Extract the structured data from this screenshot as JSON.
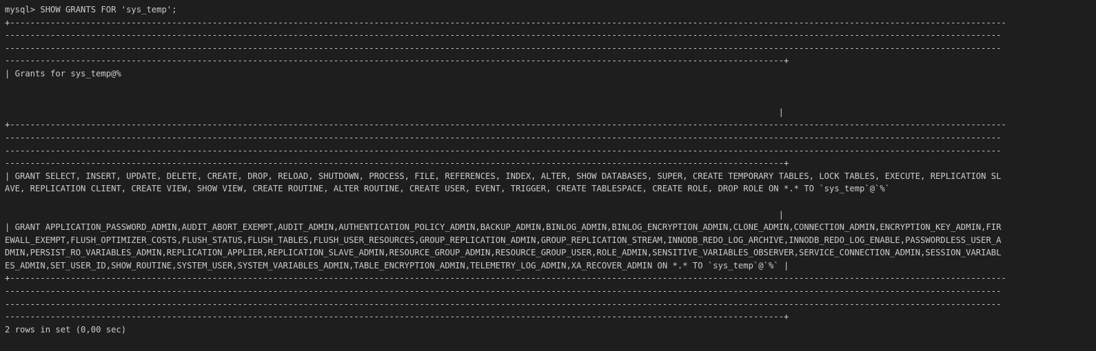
{
  "terminal": {
    "prompt": "mysql> SHOW GRANTS FOR 'sys_temp';",
    "border_top": [
      "+-----------------------------------------------------------------------------------------------------------------------------------------------------------------------------------------------------",
      "-----------------------------------------------------------------------------------------------------------------------------------------------------------------------------------------------------",
      "-----------------------------------------------------------------------------------------------------------------------------------------------------------------------------------------------------",
      "----------------------------------------------------------------------------------------------------------------------------------------------------------+"
    ],
    "header": "| Grants for sys_temp@%",
    "header_end": "                                                                                                                                                         |",
    "border_mid": [
      "+-----------------------------------------------------------------------------------------------------------------------------------------------------------------------------------------------------",
      "-----------------------------------------------------------------------------------------------------------------------------------------------------------------------------------------------------",
      "-----------------------------------------------------------------------------------------------------------------------------------------------------------------------------------------------------",
      "----------------------------------------------------------------------------------------------------------------------------------------------------------+"
    ],
    "row1": [
      "| GRANT SELECT, INSERT, UPDATE, DELETE, CREATE, DROP, RELOAD, SHUTDOWN, PROCESS, FILE, REFERENCES, INDEX, ALTER, SHOW DATABASES, SUPER, CREATE TEMPORARY TABLES, LOCK TABLES, EXECUTE, REPLICATION SL",
      "AVE, REPLICATION CLIENT, CREATE VIEW, SHOW VIEW, CREATE ROUTINE, ALTER ROUTINE, CREATE USER, EVENT, TRIGGER, CREATE TABLESPACE, CREATE ROLE, DROP ROLE ON *.* TO `sys_temp`@`%`"
    ],
    "row1_end": "                                                                                                                                                         |",
    "row2": [
      "| GRANT APPLICATION_PASSWORD_ADMIN,AUDIT_ABORT_EXEMPT,AUDIT_ADMIN,AUTHENTICATION_POLICY_ADMIN,BACKUP_ADMIN,BINLOG_ADMIN,BINLOG_ENCRYPTION_ADMIN,CLONE_ADMIN,CONNECTION_ADMIN,ENCRYPTION_KEY_ADMIN,FIR",
      "EWALL_EXEMPT,FLUSH_OPTIMIZER_COSTS,FLUSH_STATUS,FLUSH_TABLES,FLUSH_USER_RESOURCES,GROUP_REPLICATION_ADMIN,GROUP_REPLICATION_STREAM,INNODB_REDO_LOG_ARCHIVE,INNODB_REDO_LOG_ENABLE,PASSWORDLESS_USER_A",
      "DMIN,PERSIST_RO_VARIABLES_ADMIN,REPLICATION_APPLIER,REPLICATION_SLAVE_ADMIN,RESOURCE_GROUP_ADMIN,RESOURCE_GROUP_USER,ROLE_ADMIN,SENSITIVE_VARIABLES_OBSERVER,SERVICE_CONNECTION_ADMIN,SESSION_VARIABL",
      "ES_ADMIN,SET_USER_ID,SHOW_ROUTINE,SYSTEM_USER,SYSTEM_VARIABLES_ADMIN,TABLE_ENCRYPTION_ADMIN,TELEMETRY_LOG_ADMIN,XA_RECOVER_ADMIN ON *.* TO `sys_temp`@`%` |"
    ],
    "border_bottom": [
      "+-----------------------------------------------------------------------------------------------------------------------------------------------------------------------------------------------------",
      "-----------------------------------------------------------------------------------------------------------------------------------------------------------------------------------------------------",
      "-----------------------------------------------------------------------------------------------------------------------------------------------------------------------------------------------------",
      "----------------------------------------------------------------------------------------------------------------------------------------------------------+"
    ],
    "footer": "2 rows in set (0,00 sec)"
  }
}
